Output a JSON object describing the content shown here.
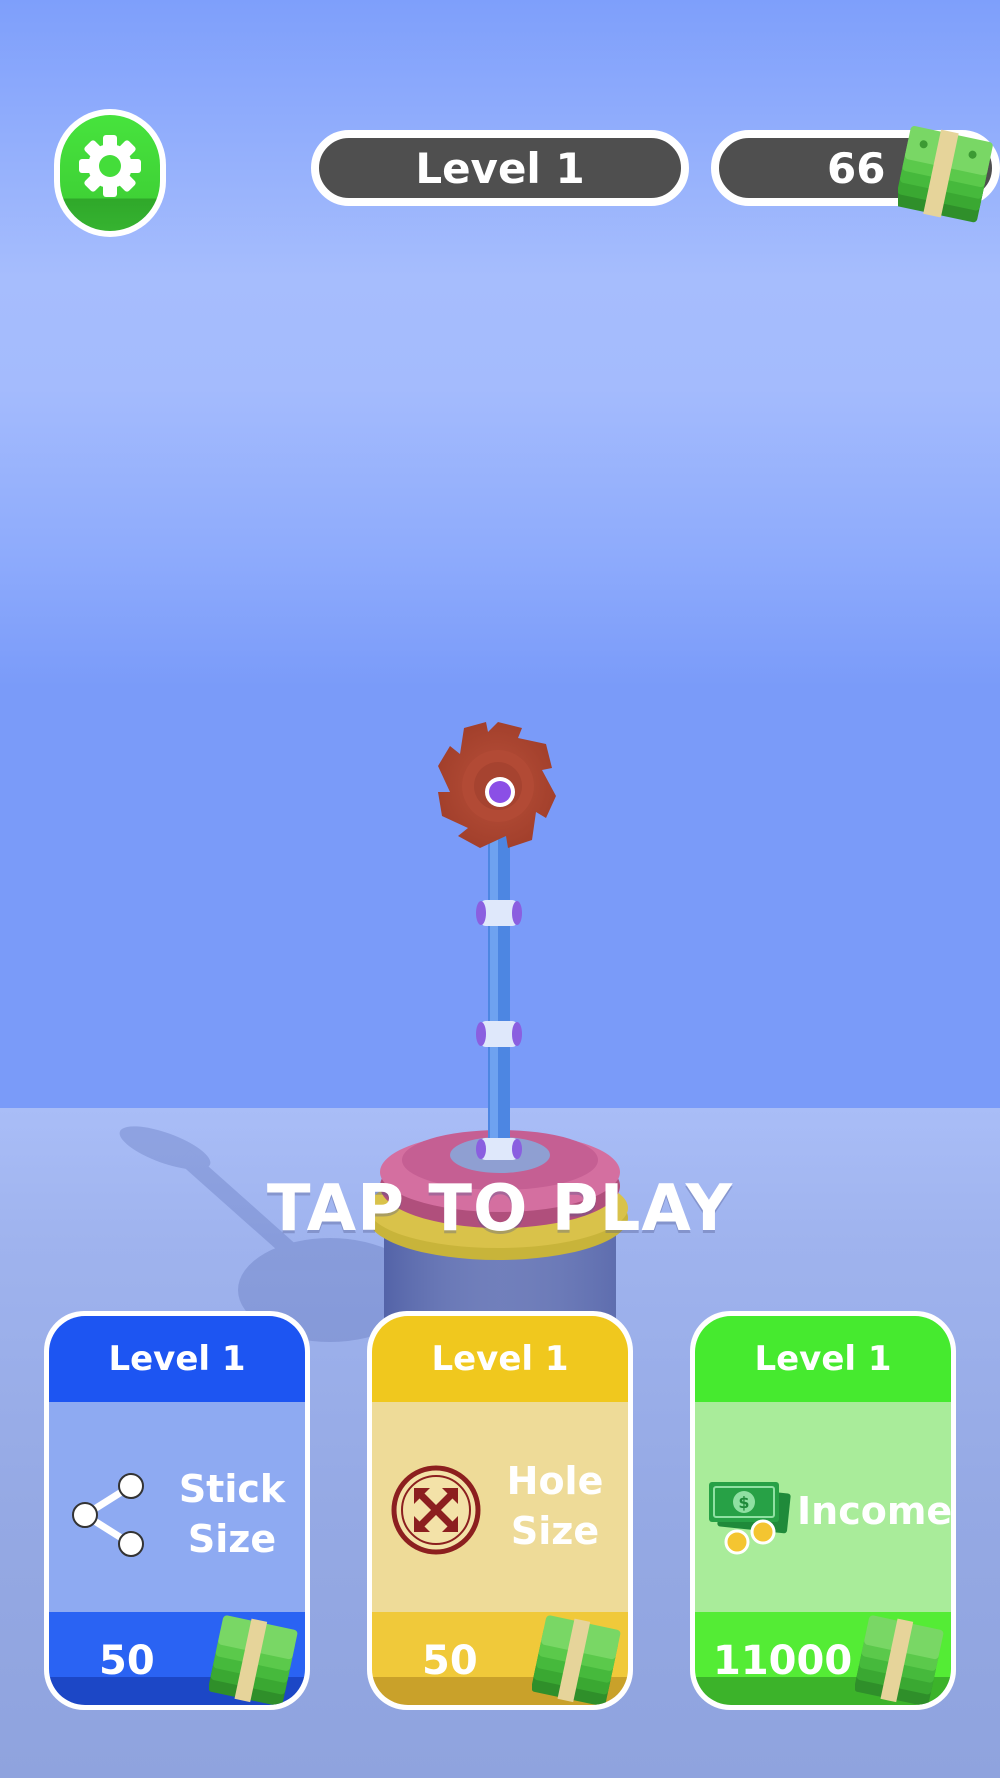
{
  "hud": {
    "level_label": "Level 1",
    "coins": "66",
    "settings_icon": "gear-icon",
    "coins_icon": "money-stack-icon"
  },
  "prompt": "TAP TO PLAY",
  "upgrades": [
    {
      "level": "Level 1",
      "label_line1": "Stick",
      "label_line2": "Size",
      "price": "50",
      "icon": "share-nodes-icon",
      "color": "#1d55f2"
    },
    {
      "level": "Level 1",
      "label_line1": "Hole",
      "label_line2": "Size",
      "price": "50",
      "icon": "expand-arrows-icon",
      "color": "#f0c81e"
    },
    {
      "level": "Level 1",
      "label_line1": "Income",
      "label_line2": "",
      "price": "11000",
      "icon": "cash-coins-icon",
      "color": "#46ea2f"
    }
  ]
}
